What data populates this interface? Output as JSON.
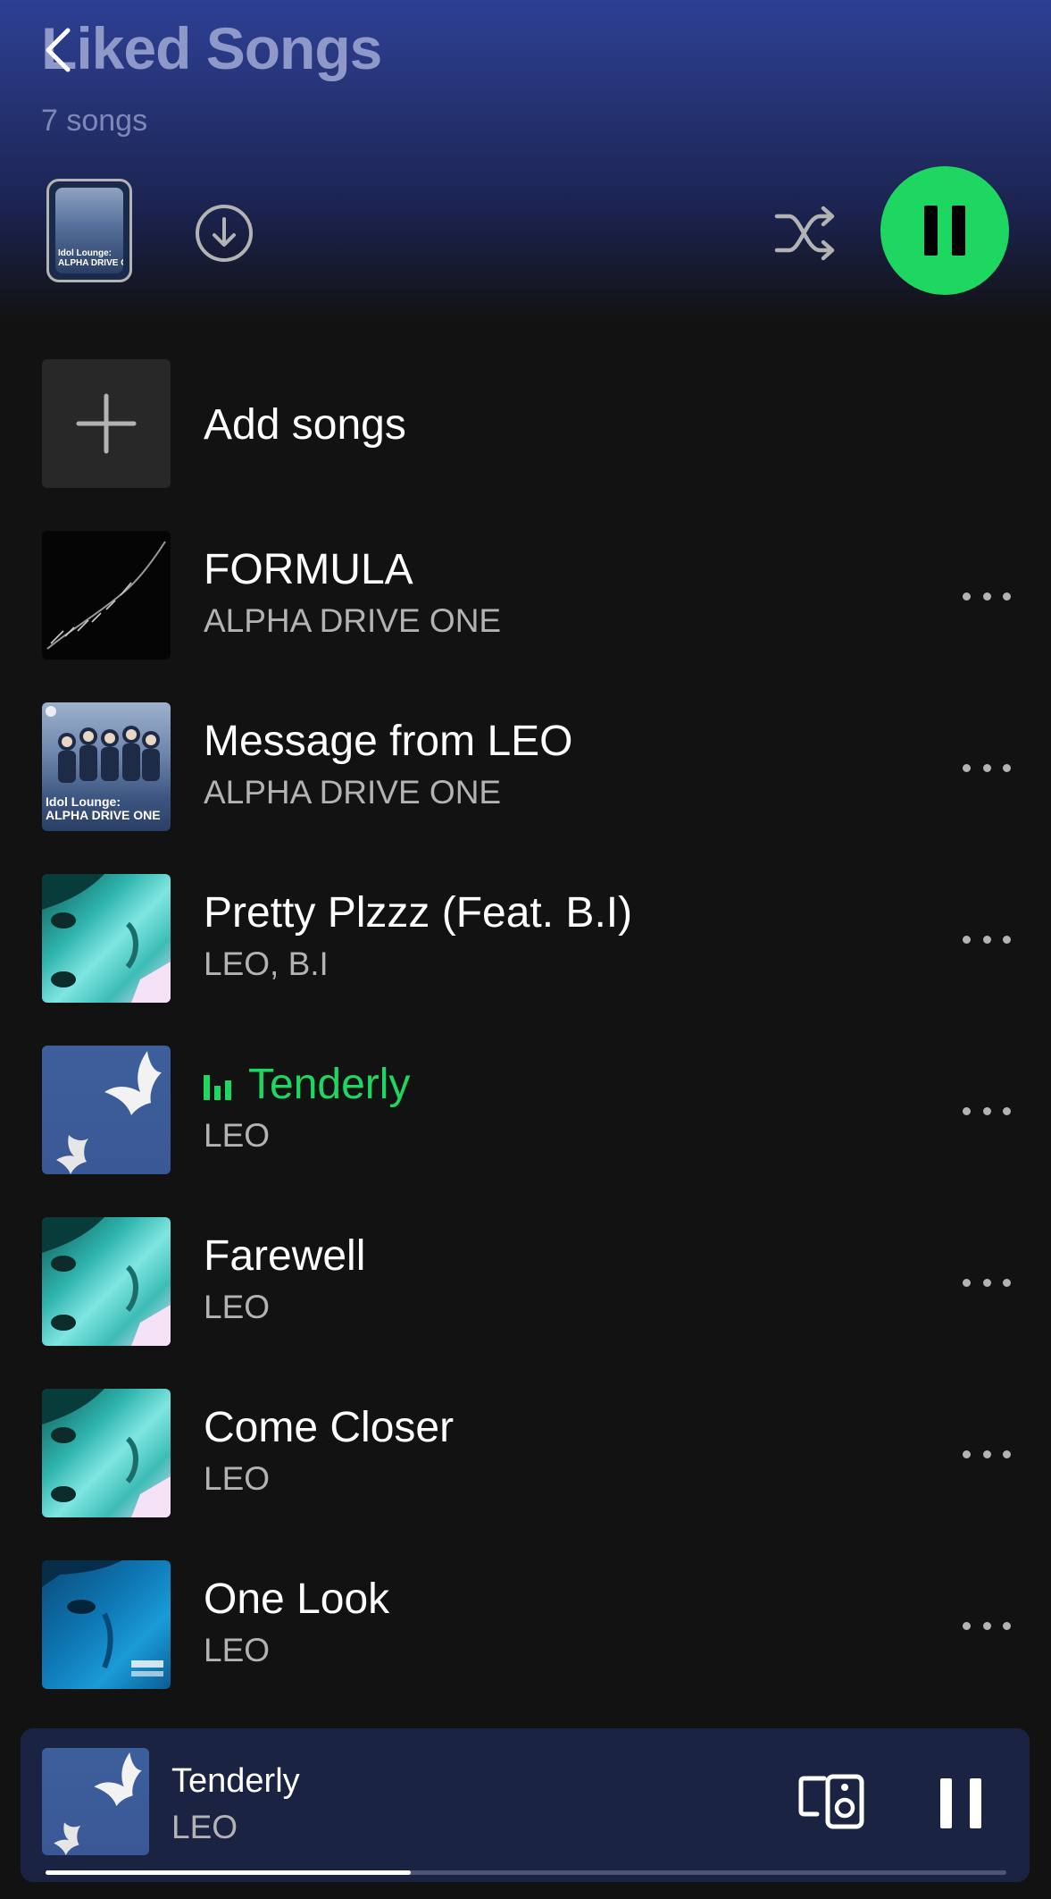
{
  "header": {
    "title": "Liked Songs",
    "count": "7 songs"
  },
  "cover": {
    "label": "Idol Lounge:\nALPHA DRIVE ONE"
  },
  "add_songs": {
    "label": "Add songs"
  },
  "songs": [
    {
      "title": "FORMULA",
      "artist": "ALPHA DRIVE ONE",
      "art": "formula",
      "playing": false
    },
    {
      "title": "Message from LEO",
      "artist": "ALPHA DRIVE ONE",
      "art": "idol-lounge",
      "art_label": "Idol Lounge:\nALPHA DRIVE ONE",
      "playing": false
    },
    {
      "title": "Pretty Plzzz (Feat. B.I)",
      "artist": "LEO, B.I",
      "art": "face",
      "playing": false
    },
    {
      "title": "Tenderly",
      "artist": "LEO",
      "art": "dove",
      "playing": true
    },
    {
      "title": "Farewell",
      "artist": "LEO",
      "art": "face",
      "playing": false
    },
    {
      "title": "Come Closer",
      "artist": "LEO",
      "art": "face",
      "playing": false
    },
    {
      "title": "One Look",
      "artist": "LEO",
      "art": "one-look",
      "playing": false
    }
  ],
  "now_playing": {
    "title": "Tenderly",
    "artist": "LEO",
    "progress": 0.38
  },
  "colors": {
    "accent": "#1ed760",
    "background": "#121212",
    "header_gradient": "#2d3f94",
    "mini_player": "#1b2342",
    "secondary_text": "#b3b3b3"
  },
  "icons": {
    "back": "chevron-left-icon",
    "download": "download-circle-icon",
    "shuffle": "shuffle-icon",
    "play_pause": "pause-icon",
    "add": "plus-icon",
    "more": "more-horizontal-icon",
    "devices": "connect-devices-icon",
    "equalizer": "equalizer-icon"
  }
}
